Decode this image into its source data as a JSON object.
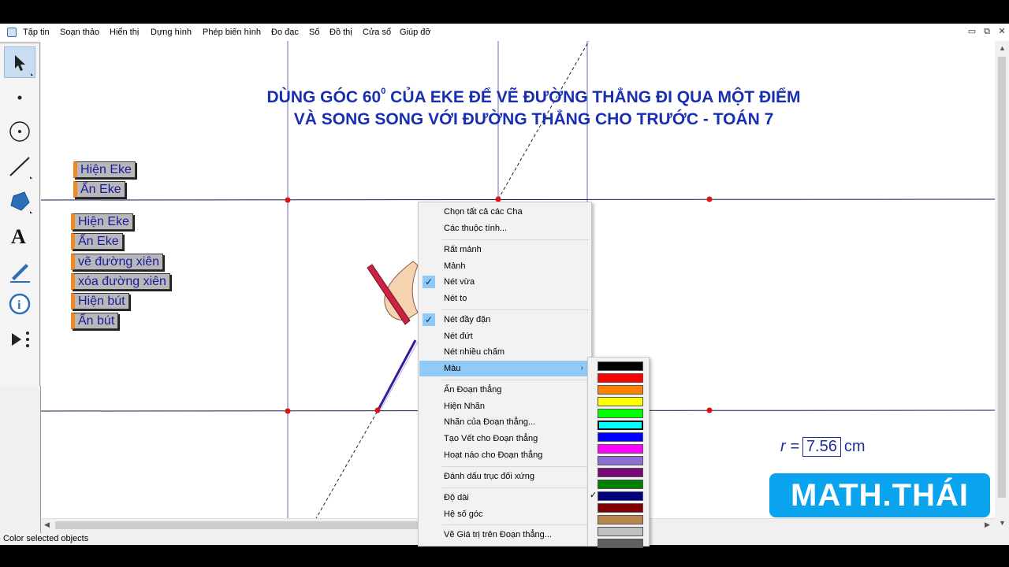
{
  "menu": [
    "Tập tin",
    "Soạn thảo",
    "Hiển thị",
    "Dựng hình",
    "Phép biến hình",
    "Đo đạc",
    "Số",
    "Đồ thị",
    "Cửa sổ",
    "Giúp đỡ"
  ],
  "window_controls": {
    "minimize": "▭",
    "restore": "⧉",
    "close": "✕"
  },
  "tools": [
    "arrow-select-icon",
    "point-icon",
    "compass-circle-icon",
    "straightedge-icon",
    "polygon-icon",
    "text-tool-icon",
    "marker-pen-icon",
    "info-icon",
    "custom-tools-icon"
  ],
  "title": {
    "line1_pre": "DÙNG GÓC 60",
    "line1_sup": "0",
    "line1_post": " CỦA EKE ĐỂ VẼ ĐƯỜNG THẲNG ĐI QUA MỘT ĐIỂM",
    "line2": "VÀ SONG SONG VỚI ĐƯỜNG THẲNG CHO TRƯỚC - TOÁN 7"
  },
  "buttons": [
    "Hiện Eke",
    "Ẩn Eke",
    "Hiện Eke",
    "Ẩn Eke",
    "vẽ đường xiên",
    "xóa đường xiên",
    "Hiện bút",
    "Ẩn bút"
  ],
  "measure": {
    "label": "r =",
    "value": "7.56",
    "unit": "cm"
  },
  "logo": "MATH.THÁI",
  "status": "Color selected objects",
  "context_menu": {
    "items": [
      {
        "label": "Chọn tất cả các Cha",
        "checked": false,
        "highlight": false,
        "submenu": false
      },
      {
        "label": "Các thuộc tính...",
        "checked": false,
        "highlight": false,
        "submenu": false
      },
      {
        "label": "Rất mảnh",
        "checked": false,
        "highlight": false,
        "submenu": false
      },
      {
        "label": "Mảnh",
        "checked": false,
        "highlight": false,
        "submenu": false
      },
      {
        "label": "Nét vừa",
        "checked": true,
        "highlight": false,
        "submenu": false
      },
      {
        "label": "Nét to",
        "checked": false,
        "highlight": false,
        "submenu": false
      },
      {
        "label": "Nét đầy đặn",
        "checked": true,
        "highlight": false,
        "submenu": false
      },
      {
        "label": "Nét đứt",
        "checked": false,
        "highlight": false,
        "submenu": false
      },
      {
        "label": "Nét nhiều chấm",
        "checked": false,
        "highlight": false,
        "submenu": false
      },
      {
        "label": "Màu",
        "checked": false,
        "highlight": true,
        "submenu": true
      },
      {
        "label": "Ẩn Đoạn thẳng",
        "checked": false,
        "highlight": false,
        "submenu": false
      },
      {
        "label": "Hiện Nhãn",
        "checked": false,
        "highlight": false,
        "submenu": false
      },
      {
        "label": "Nhãn của Đoạn thẳng...",
        "checked": false,
        "highlight": false,
        "submenu": false
      },
      {
        "label": "Tạo Vết cho Đoạn thẳng",
        "checked": false,
        "highlight": false,
        "submenu": false
      },
      {
        "label": "Hoạt náo cho Đoạn thẳng",
        "checked": false,
        "highlight": false,
        "submenu": false
      },
      {
        "label": "Đánh dấu trục đối xứng",
        "checked": false,
        "highlight": false,
        "submenu": false
      },
      {
        "label": "Độ dài",
        "checked": false,
        "highlight": false,
        "submenu": false
      },
      {
        "label": "Hệ số góc",
        "checked": false,
        "highlight": false,
        "submenu": false
      },
      {
        "label": "Vẽ Giá trị trên Đoạn thẳng...",
        "checked": false,
        "highlight": false,
        "submenu": false
      }
    ]
  },
  "color_palette": {
    "colors": [
      "#000000",
      "#ff0000",
      "#ff8000",
      "#ffff00",
      "#00ff00",
      "#00ffff",
      "#0000ff",
      "#ff00ff",
      "#8c6fd0",
      "#7a0a7a",
      "#008000",
      "#000080",
      "#800000",
      "#b8864b",
      "#c0c0c0",
      "#606060"
    ],
    "selected_index": 5,
    "checked_index": 11
  }
}
